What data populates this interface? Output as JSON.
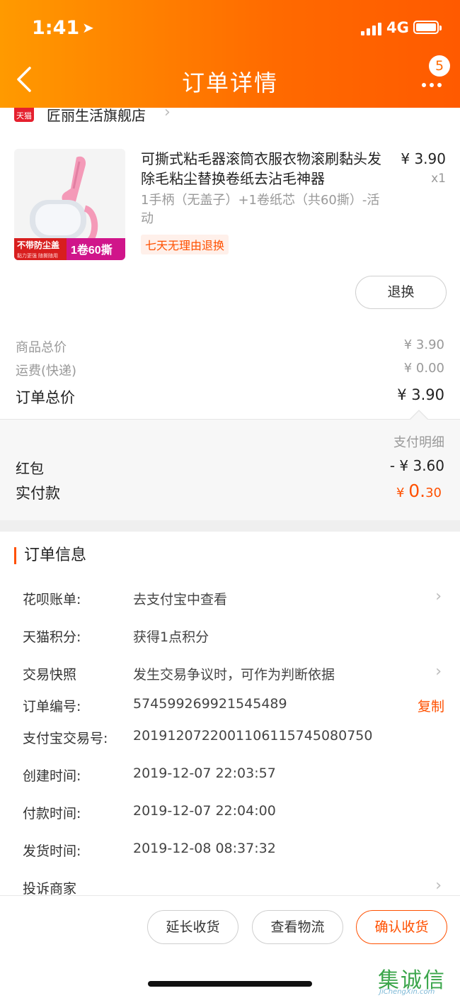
{
  "status_bar": {
    "time": "1:41",
    "network": "4G"
  },
  "header": {
    "title": "订单详情",
    "badge_count": "5"
  },
  "shop": {
    "logo_text": "天猫",
    "name": "匠丽生活旗舰店"
  },
  "product": {
    "title": "可撕式粘毛器滚筒衣服衣物滚刷黏头发除毛粘尘替换卷纸去沾毛神器",
    "price": "¥ 3.90",
    "quantity": "x1",
    "sku": "1手柄（无盖子）+1卷纸芯（共60撕）-活动",
    "return_tag": "七天无理由退换",
    "image_banner_left": "不带防尘盖",
    "image_banner_left_sub": "黏力更强 随撕随用",
    "image_banner_right": "1卷60撕",
    "refund_button": "退换"
  },
  "summary": {
    "goods_total_label": "商品总价",
    "goods_total_value": "¥ 3.90",
    "shipping_label": "运费(快递)",
    "shipping_value": "¥ 0.00",
    "order_total_label": "订单总价",
    "order_total_value": "¥ 3.90"
  },
  "payment": {
    "detail_title": "支付明细",
    "redpack_label": "红包",
    "redpack_value": "- ¥ 3.60",
    "actual_label": "实付款",
    "actual_currency": "¥",
    "actual_int": "0.",
    "actual_dec": "30"
  },
  "order_info": {
    "title": "订单信息",
    "rows": [
      {
        "label": "花呗账单:",
        "value": "去支付宝中查看"
      },
      {
        "label": "天猫积分:",
        "value": "获得1点积分"
      },
      {
        "label": "交易快照",
        "value": "发生交易争议时，可作为判断依据"
      },
      {
        "label": "订单编号:",
        "value": "574599269921545489",
        "action": "复制"
      },
      {
        "label": "支付宝交易号:",
        "value": "2019120722001106115745080750"
      },
      {
        "label": "创建时间:",
        "value": "2019-12-07 22:03:57"
      },
      {
        "label": "付款时间:",
        "value": "2019-12-07 22:04:00"
      },
      {
        "label": "发货时间:",
        "value": "2019-12-08 08:37:32"
      },
      {
        "label": "投诉商家",
        "value": ""
      }
    ]
  },
  "actions": {
    "extend_receipt": "延长收货",
    "view_logistics": "查看物流",
    "confirm_receipt": "确认收货"
  },
  "watermark": {
    "glyphs": "集诚信",
    "sub": "JiChengXin.com"
  },
  "colors": {
    "accent": "#ff5000",
    "header_start": "#ff9a00",
    "header_end": "#ff5a00"
  }
}
